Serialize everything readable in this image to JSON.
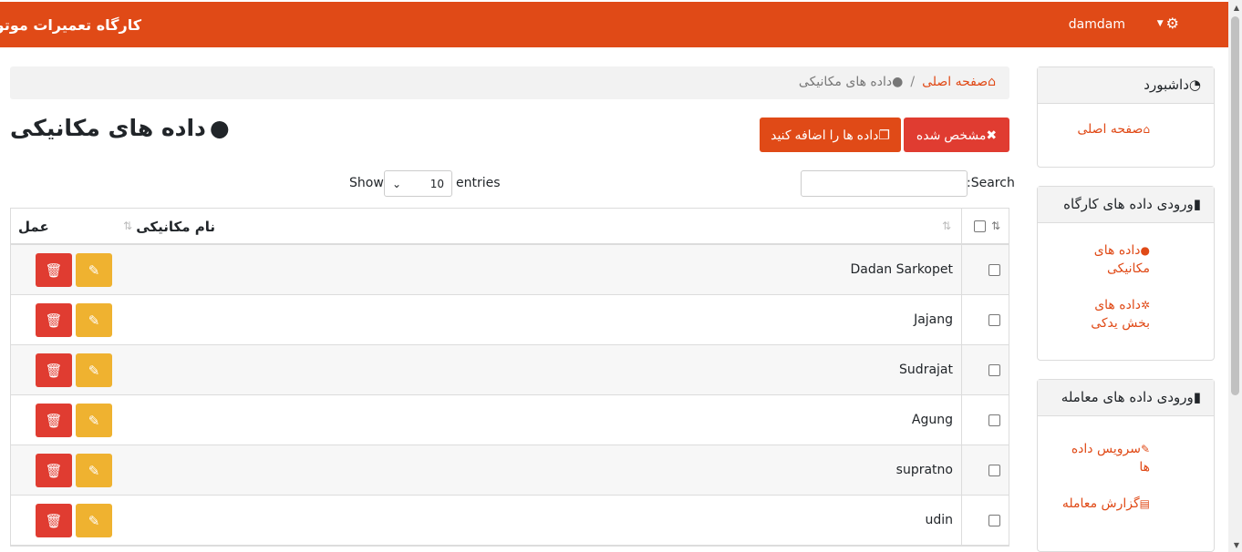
{
  "app": {
    "title": "کارگاه تعمیرات موتور",
    "user": "damdam"
  },
  "sidebar": {
    "dashboard": {
      "title": "داشبورد",
      "links": [
        "صفحه اصلی"
      ]
    },
    "workshop": {
      "title": "ورودی داده های کارگاه",
      "links": [
        "داده های مکانیکی",
        "داده های بخش یدکی"
      ]
    },
    "transaction": {
      "title": "ورودی داده های معامله",
      "links": [
        "سرویس داده ها",
        "گزارش معامله"
      ]
    }
  },
  "breadcrumb": {
    "home": "صفحه اصلی",
    "current": "داده های مکانیکی"
  },
  "page": {
    "title": "داده های مکانیکی",
    "clear_label": "مشخص شده",
    "add_label": "داده ها را اضافه کنید",
    "search_label": "Search:",
    "show_label": "Show",
    "show_value": "10",
    "entries_label": "entries"
  },
  "table": {
    "headers": {
      "name": "نام مکانیکی",
      "action": "عمل"
    },
    "rows": [
      "Dadan Sarkopet",
      "Jajang",
      "Sudrajat",
      "Agung",
      "supratno",
      "udin"
    ]
  },
  "colors": {
    "primary": "#e04a17",
    "danger": "#e03c31",
    "warning": "#efb230"
  }
}
